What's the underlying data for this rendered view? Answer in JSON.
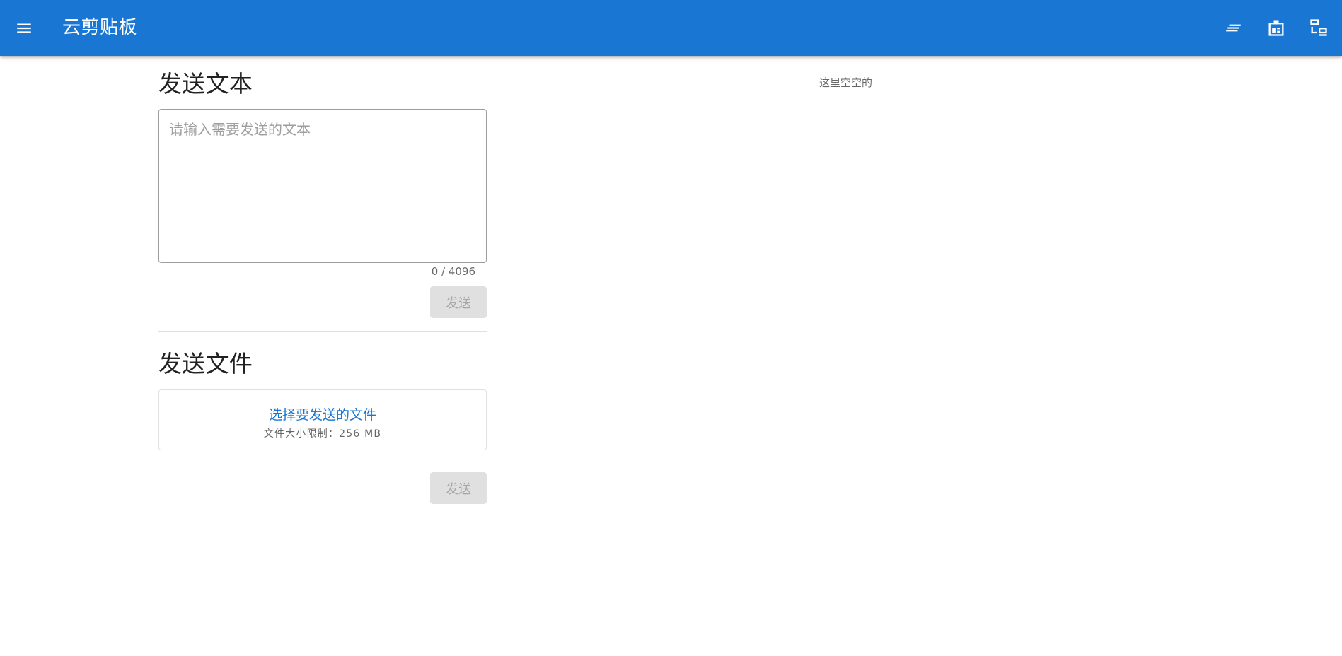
{
  "header": {
    "title": "云剪贴板",
    "colors": {
      "primary": "#1976d2",
      "on_primary": "#ffffff"
    },
    "icons": {
      "menu": "menu-icon",
      "history": "text-lines-icon",
      "files": "badge-icon",
      "devices": "devices-icon"
    }
  },
  "text_section": {
    "title": "发送文本",
    "placeholder": "请输入需要发送的文本",
    "counter": "0 / 4096",
    "send_label": "发送"
  },
  "file_section": {
    "title": "发送文件",
    "select_label": "选择要发送的文件",
    "size_limit": "文件大小限制：256 MB",
    "send_label": "发送"
  },
  "history": {
    "empty_text": "这里空空的"
  }
}
